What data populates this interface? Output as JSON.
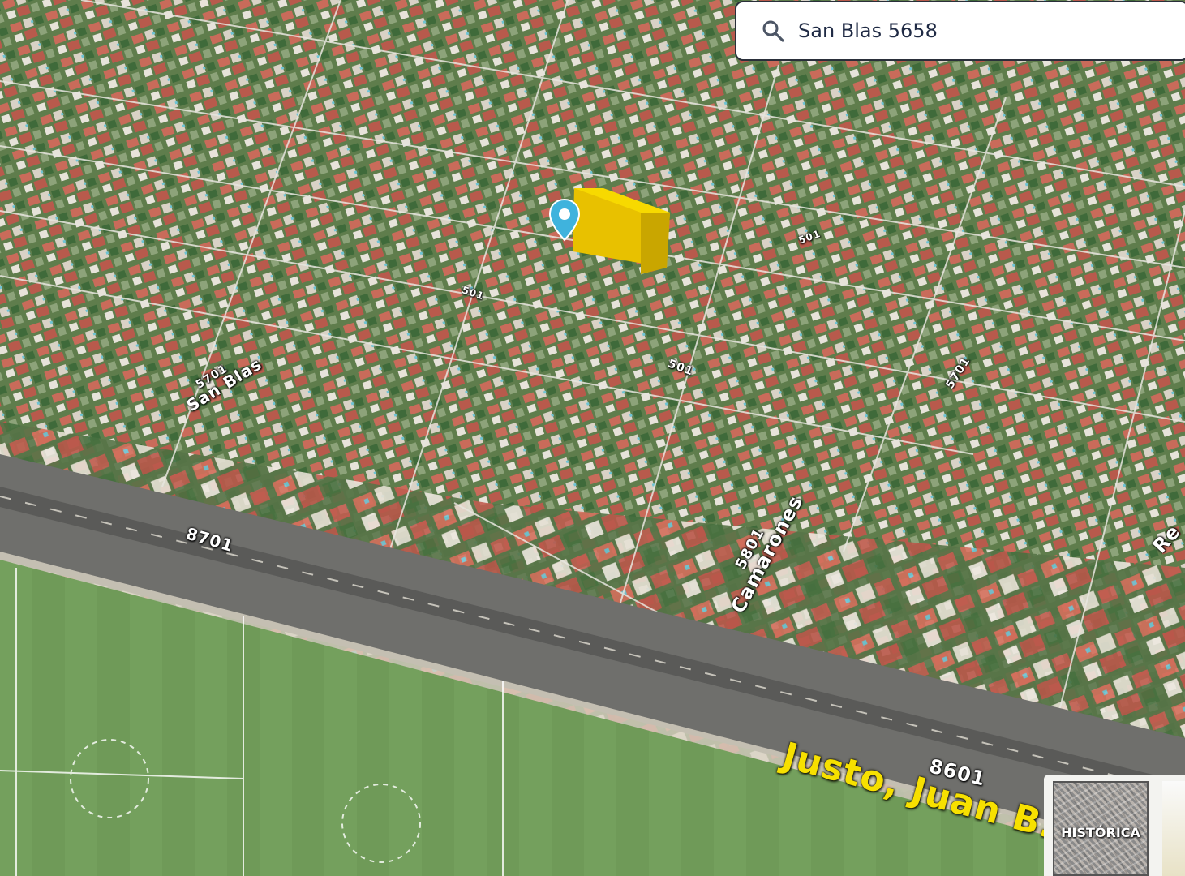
{
  "search": {
    "value": "San Blas 5658",
    "icon": "search-icon"
  },
  "labels": {
    "juan_b_justo": "Justo, Juan B.",
    "n8601": "8601",
    "n8701": "8701",
    "camarones": "Camarones",
    "n5801": "5801",
    "san_blas": "San Blas",
    "n5701_left": "5701",
    "n5701_right": "5701",
    "n501_a": "501",
    "n501_b": "501",
    "n501_c": "501",
    "partial_r": "Re"
  },
  "historica": {
    "label": "HISTÓRICA"
  },
  "marker": {
    "icon": "location-pin-icon",
    "color": "#3fb3dd"
  },
  "highlight_color": "#f1c900"
}
